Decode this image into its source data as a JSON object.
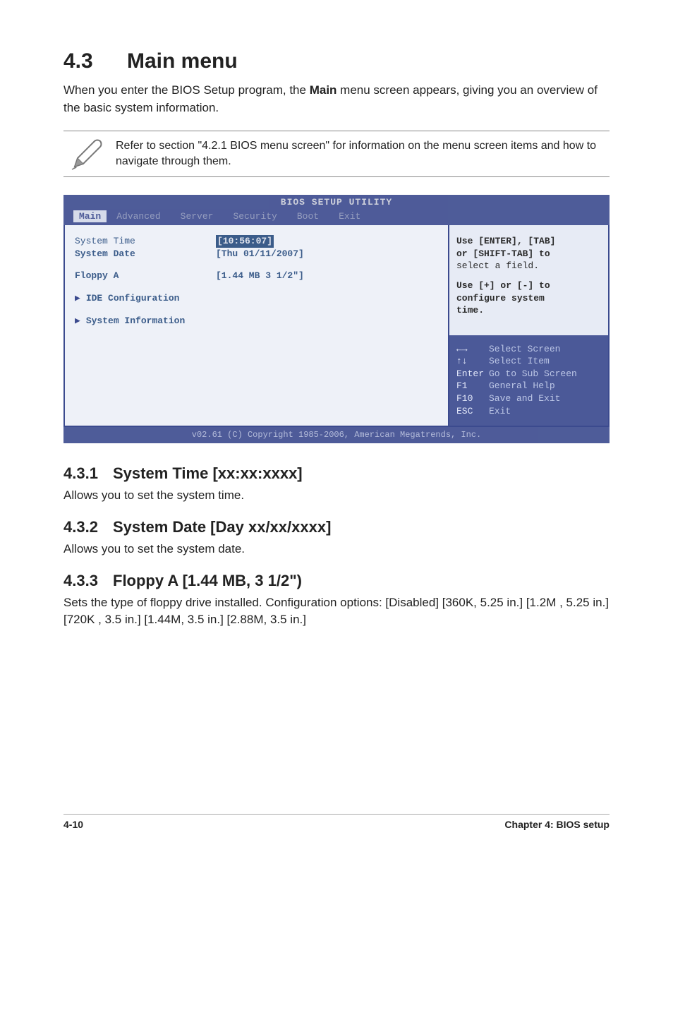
{
  "section": {
    "number": "4.3",
    "title": "Main menu",
    "intro_a": "When you enter the BIOS Setup program, the ",
    "intro_b": "Main",
    "intro_c": " menu screen appears, giving you an overview of the basic system information."
  },
  "note": {
    "text": "Refer to section \"4.2.1 BIOS menu screen\" for information on the menu screen items and how to navigate through them."
  },
  "bios": {
    "title": "BIOS SETUP UTILITY",
    "tabs": [
      "Main",
      "Advanced",
      "Server",
      "Security",
      "Boot",
      "Exit"
    ],
    "active_tab": "Main",
    "left": {
      "system_time_label": "System Time",
      "system_time_value": "[10:56:07]",
      "system_date_label": "System Date",
      "system_date_value": "[Thu 01/11/2007]",
      "floppy_label": "Floppy A",
      "floppy_value": "[1.44 MB 3 1/2\"]",
      "ide_conf": "IDE Configuration",
      "sys_info": "System Information"
    },
    "help_top": {
      "l1": "Use [ENTER], [TAB]",
      "l2": "or [SHIFT-TAB] to",
      "l3": "select a field.",
      "l4": "Use [+] or [-] to",
      "l5": "configure system",
      "l6": "time."
    },
    "help_bottom": {
      "k1": "←→",
      "v1": "Select Screen",
      "k2": "↑↓",
      "v2": "Select Item",
      "k3": "Enter",
      "v3": "Go to Sub Screen",
      "k4": "F1",
      "v4": "General Help",
      "k5": "F10",
      "v5": "Save and Exit",
      "k6": "ESC",
      "v6": "Exit"
    },
    "footer": "v02.61 (C) Copyright 1985-2006, American Megatrends, Inc."
  },
  "sub1": {
    "num": "4.3.1",
    "title": "System Time [xx:xx:xxxx]",
    "body": "Allows you to set the system time."
  },
  "sub2": {
    "num": "4.3.2",
    "title": "System Date [Day xx/xx/xxxx]",
    "body": "Allows you to set the system date."
  },
  "sub3": {
    "num": "4.3.3",
    "title": "Floppy A [1.44 MB, 3 1/2\")",
    "body": "Sets the type of floppy drive installed. Configuration options: [Disabled] [360K, 5.25 in.] [1.2M , 5.25 in.] [720K , 3.5 in.] [1.44M, 3.5 in.] [2.88M, 3.5 in.]"
  },
  "footer": {
    "left": "4-10",
    "right": "Chapter 4: BIOS setup"
  }
}
